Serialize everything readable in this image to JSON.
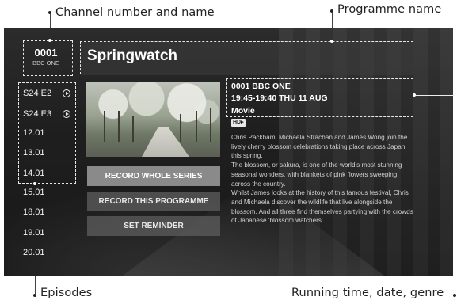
{
  "annotations": {
    "channel": "Channel number and name",
    "programme": "Programme name",
    "episodes": "Episodes",
    "running": "Running time, date, genre"
  },
  "channel": {
    "number": "0001",
    "name": "BBC ONE"
  },
  "programme": {
    "title": "Springwatch"
  },
  "episodes": [
    {
      "label": "S24 E2",
      "has_play": true
    },
    {
      "label": "S24 E3",
      "has_play": true
    },
    {
      "label": "12.01",
      "has_play": false
    },
    {
      "label": "13.01",
      "has_play": false
    },
    {
      "label": "14.01",
      "has_play": false
    },
    {
      "label": "15.01",
      "has_play": false
    },
    {
      "label": "18.01",
      "has_play": false
    },
    {
      "label": "19.01",
      "has_play": false
    },
    {
      "label": "20.01",
      "has_play": false
    }
  ],
  "info": {
    "channel_line": "0001 BBC ONE",
    "time_line": "19:45-19:40 THU 11 AUG",
    "genre": "Movie",
    "hd_badge": "HD▸"
  },
  "buttons": {
    "record_series": "RECORD WHOLE SERIES",
    "record_programme": "RECORD THIS PROGRAMME",
    "reminder": "SET REMINDER"
  },
  "description": [
    "Chris Packham, Michaela Strachan and James Wong join the lively cherry blossom celebrations taking place across Japan this spring.",
    "The blossom, or sakura, is one of the world's most stunning seasonal wonders, with blankets of pink flowers sweeping across the country.",
    "Whilst James looks at the history of this famous festival, Chris and Michaela discover the wildlife that live alongside the blossom. And all three find themselves partying with the crowds of Japanese 'blossom watchers'."
  ]
}
